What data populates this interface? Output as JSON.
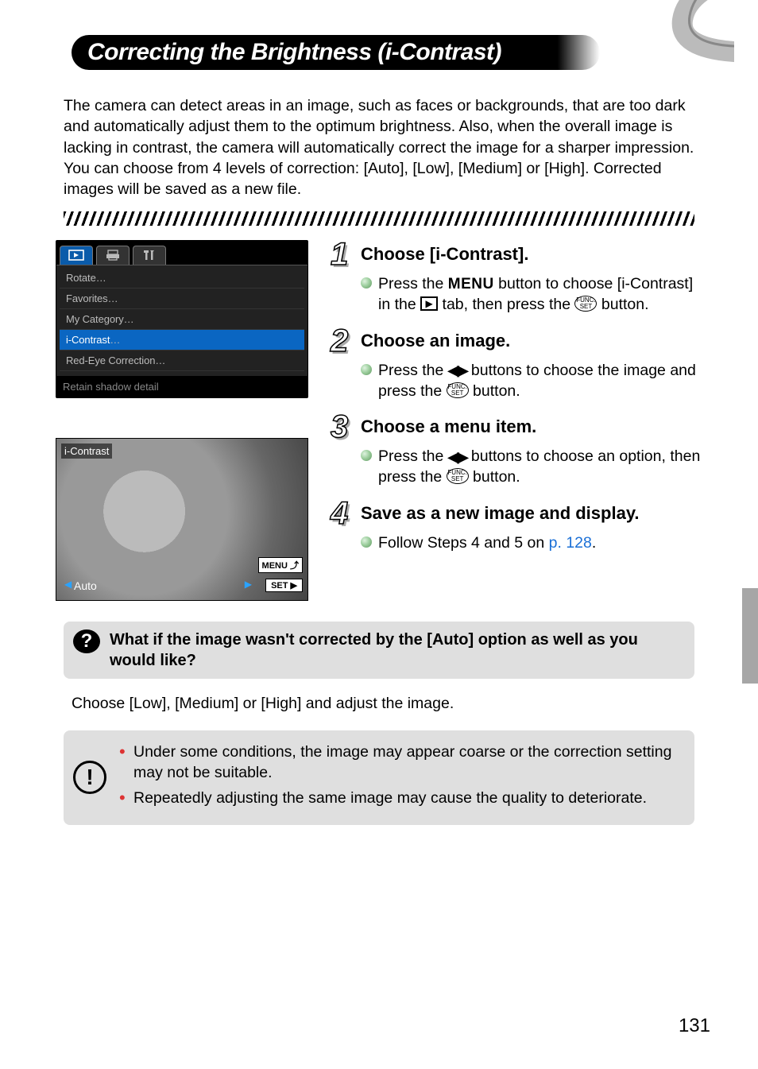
{
  "page_number": "131",
  "title": "Correcting the Brightness (i-Contrast)",
  "intro": "The camera can detect areas in an image, such as faces or backgrounds, that are too dark and automatically adjust them to the optimum brightness. Also, when the overall image is lacking in contrast, the camera will automatically correct the image for a sharper impression.  You can choose from 4 levels of correction: [Auto], [Low], [Medium] or [High]. Corrected images will be saved as a new file.",
  "menu_shot": {
    "items": [
      "Rotate",
      "Favorites",
      "My Category",
      "i-Contrast",
      "Red-Eye Correction"
    ],
    "footer": "Retain shadow detail",
    "selected_index": 3
  },
  "preview_shot": {
    "top_label": "i-Contrast",
    "bottom_value": "Auto",
    "corner_menu": "MENU",
    "corner_set": "SET"
  },
  "steps": [
    {
      "num": "1",
      "title": "Choose [i-Contrast].",
      "bullets": [
        {
          "parts": [
            {
              "t": "Press the "
            },
            {
              "glyph": "MENU"
            },
            {
              "t": " button to choose [i-Contrast] in the "
            },
            {
              "glyph": "PLAY"
            },
            {
              "t": " tab, then press the "
            },
            {
              "glyph": "FUNC"
            },
            {
              "t": " button."
            }
          ]
        }
      ]
    },
    {
      "num": "2",
      "title": "Choose an image.",
      "bullets": [
        {
          "parts": [
            {
              "t": "Press the "
            },
            {
              "glyph": "LR"
            },
            {
              "t": " buttons to choose the image and press the "
            },
            {
              "glyph": "FUNC"
            },
            {
              "t": " button."
            }
          ]
        }
      ]
    },
    {
      "num": "3",
      "title": "Choose a menu item.",
      "bullets": [
        {
          "parts": [
            {
              "t": "Press the "
            },
            {
              "glyph": "LR"
            },
            {
              "t": " buttons to choose an option, then press the "
            },
            {
              "glyph": "FUNC"
            },
            {
              "t": " button."
            }
          ]
        }
      ]
    },
    {
      "num": "4",
      "title": "Save as a new image and display.",
      "bullets": [
        {
          "parts": [
            {
              "t": "Follow Steps 4 and 5 on "
            },
            {
              "link": "p. 128"
            },
            {
              "t": "."
            }
          ]
        }
      ]
    }
  ],
  "qa": {
    "q_icon": "?",
    "q_title": "What if the image wasn't corrected by the [Auto] option as well as you would like?",
    "answer": "Choose [Low], [Medium] or [High] and adjust the image."
  },
  "caution": [
    "Under some conditions, the image may appear coarse or the correction setting may not be suitable.",
    "Repeatedly adjusting the same image may cause the quality to deteriorate."
  ]
}
